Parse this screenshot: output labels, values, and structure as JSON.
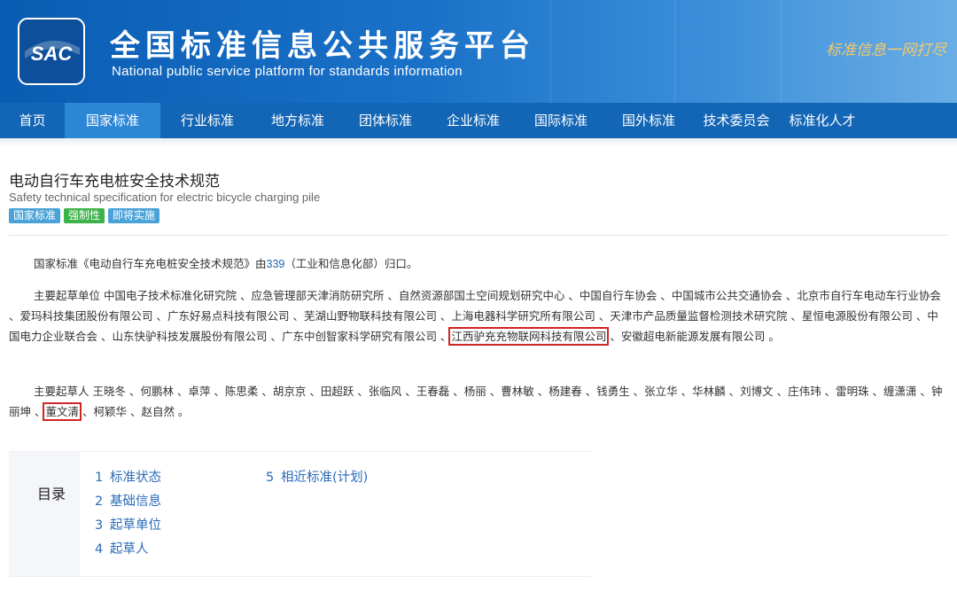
{
  "header": {
    "logo_text": "SAC",
    "title_cn": "全国标准信息公共服务平台",
    "title_en": "National public service platform  for standards information",
    "slogan": "标准信息一网打尽",
    "colors": {
      "banner": "#1366b5",
      "active_nav": "#2b86d6"
    }
  },
  "nav": {
    "items": [
      {
        "label": "首页"
      },
      {
        "label": "国家标准",
        "active": true
      },
      {
        "label": "行业标准"
      },
      {
        "label": "地方标准"
      },
      {
        "label": "团体标准"
      },
      {
        "label": "企业标准"
      },
      {
        "label": "国际标准"
      },
      {
        "label": "国外标准"
      },
      {
        "label": "技术委员会"
      },
      {
        "label": "标准化人才"
      }
    ]
  },
  "standard": {
    "title_cn": "电动自行车充电桩安全技术规范",
    "title_en": "Safety technical specification for electric bicycle charging pile",
    "tags": [
      "国家标准",
      "强制性",
      "即将实施"
    ]
  },
  "content": {
    "p1_a": "国家标准《电动自行车充电桩安全技术规范》由",
    "p1_link": "339",
    "p1_b": "（工业和信息化部）归口。",
    "p2_label": "主要起草单位",
    "p2_a": " 中国电子技术标准化研究院 、应急管理部天津消防研究所 、自然资源部国土空间规划研究中心 、中国自行车协会 、中国城市公共交通协会 、北京市自行车电动车行业协会 、爱玛科技集团股份有限公司 、广东好易点科技有限公司 、芜湖山野物联科技有限公司 、上海电器科学研究所有限公司 、天津市产品质量监督检测技术研究院 、星恒电源股份有限公司 、中国电力企业联合会 、山东快驴科技发展股份有限公司 、广东中创智家科学研究有限公司 、",
    "p2_hl": "江西驴充充物联网科技有限公司",
    "p2_b": " 、安徽超电新能源发展有限公司 。",
    "p3_label": "主要起草人",
    "p3_a": " 王晓冬 、何鹏林 、卓萍 、陈思柔 、胡京京 、田超跃 、张临风 、王春磊 、杨丽 、曹林敏 、杨建春 、钱勇生 、张立华 、华林麟 、刘博文 、庄伟玮 、雷明珠 、缠潇潇 、钟丽坤 、",
    "p3_hl": "董文清",
    "p3_b": " 、柯颖华 、赵自然 。"
  },
  "toc": {
    "heading": "目录",
    "col1": [
      {
        "num": "1",
        "label": "标准状态"
      },
      {
        "num": "2",
        "label": "基础信息"
      },
      {
        "num": "3",
        "label": "起草单位"
      },
      {
        "num": "4",
        "label": "起草人"
      }
    ],
    "col2": [
      {
        "num": "5",
        "label": "相近标准(计划)"
      }
    ]
  }
}
